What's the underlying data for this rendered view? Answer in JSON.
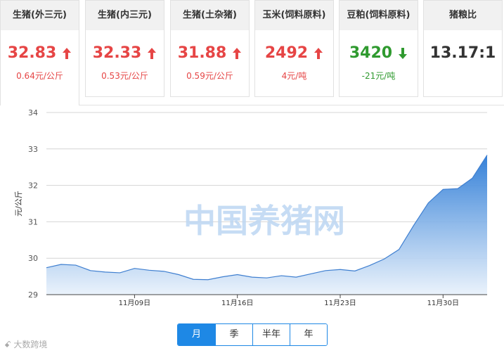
{
  "cards": [
    {
      "title": "生猪(外三元)",
      "price": "32.83",
      "change": "0.64元/公斤",
      "trend": "up"
    },
    {
      "title": "生猪(内三元)",
      "price": "32.33",
      "change": "0.53元/公斤",
      "trend": "up"
    },
    {
      "title": "生猪(土杂猪)",
      "price": "31.88",
      "change": "0.59元/公斤",
      "trend": "up"
    },
    {
      "title": "玉米(饲料原料)",
      "price": "2492",
      "change": "4元/吨",
      "trend": "up"
    },
    {
      "title": "豆粕(饲料原料)",
      "price": "3420",
      "change": "-21元/吨",
      "trend": "down"
    },
    {
      "title": "猪粮比",
      "price": "13.17:1",
      "change": "",
      "trend": "none"
    }
  ],
  "colors": {
    "up": "#e64545",
    "down": "#2f9a2f",
    "accent": "#1e88e5",
    "area_top": "#2a7ad6",
    "area_bottom": "#e8f1fb"
  },
  "watermark": "中国养猪网",
  "logo_text": "大数跨境",
  "tabs": [
    {
      "label": "月",
      "active": true
    },
    {
      "label": "季",
      "active": false
    },
    {
      "label": "半年",
      "active": false
    },
    {
      "label": "年",
      "active": false
    }
  ],
  "chart_data": {
    "type": "area",
    "title": "",
    "xlabel": "",
    "ylabel": "元/公斤",
    "ylim": [
      29,
      34
    ],
    "yticks": [
      29,
      30,
      31,
      32,
      33,
      34
    ],
    "x": [
      "11月03日",
      "11月04日",
      "11月05日",
      "11月06日",
      "11月07日",
      "11月08日",
      "11月09日",
      "11月10日",
      "11月11日",
      "11月12日",
      "11月13日",
      "11月14日",
      "11月15日",
      "11月16日",
      "11月17日",
      "11月18日",
      "11月19日",
      "11月20日",
      "11月21日",
      "11月22日",
      "11月23日",
      "11月24日",
      "11月25日",
      "11月26日",
      "11月27日",
      "11月28日",
      "11月29日",
      "11月30日",
      "12月01日",
      "12月02日",
      "12月03日"
    ],
    "xticks": [
      "11月09日",
      "11月16日",
      "11月23日",
      "11月30日"
    ],
    "values": [
      29.74,
      29.83,
      29.81,
      29.66,
      29.62,
      29.6,
      29.72,
      29.67,
      29.64,
      29.55,
      29.42,
      29.41,
      29.49,
      29.55,
      29.48,
      29.46,
      29.52,
      29.48,
      29.57,
      29.66,
      29.69,
      29.65,
      29.8,
      29.98,
      30.24,
      30.9,
      31.52,
      31.89,
      31.91,
      32.2,
      32.83
    ],
    "grid": true
  }
}
